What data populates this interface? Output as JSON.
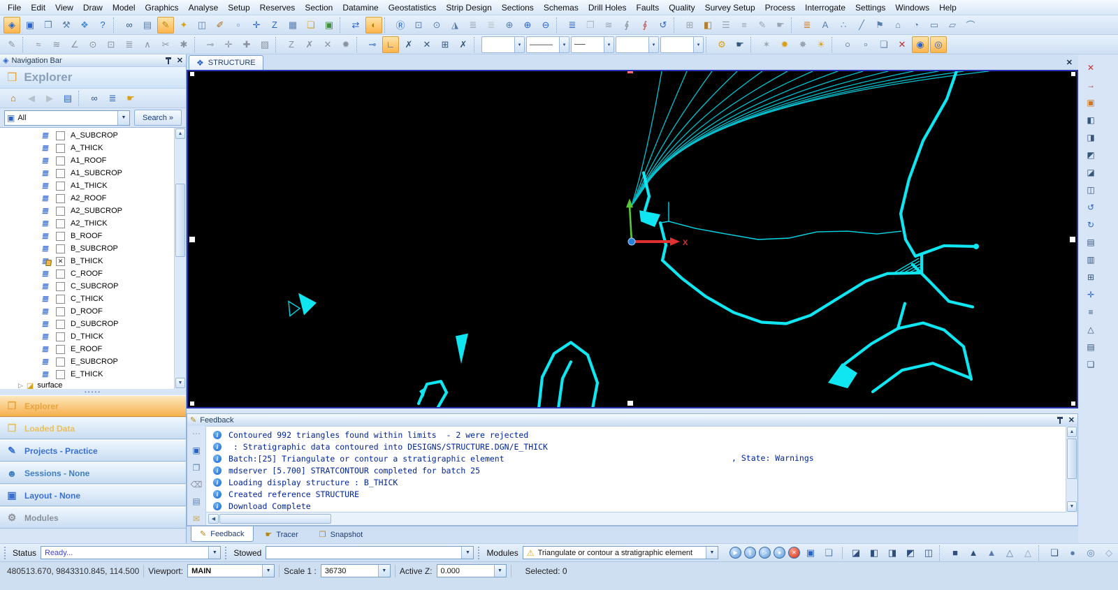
{
  "menu_items": [
    "File",
    "Edit",
    "View",
    "Draw",
    "Model",
    "Graphics",
    "Analyse",
    "Setup",
    "Reserves",
    "Section",
    "Datamine",
    "Geostatistics",
    "Strip Design",
    "Sections",
    "Schemas",
    "Drill Holes",
    "Faults",
    "Quality",
    "Survey Setup",
    "Process",
    "Interrogate",
    "Settings",
    "Windows",
    "Help"
  ],
  "toolbar1": [
    {
      "name": "rotate-view-icon",
      "glyph": "◈",
      "active": true,
      "color": "#2a64c8"
    },
    {
      "name": "plane-view-icon",
      "glyph": "▣",
      "color": "#2a64c8"
    },
    {
      "name": "cascade-windows-icon",
      "glyph": "❐",
      "color": "#5a7fae"
    },
    {
      "name": "customise-icon",
      "glyph": "⚒",
      "color": "#5a7fae"
    },
    {
      "name": "plugins-icon",
      "glyph": "❖",
      "color": "#4a8fd4"
    },
    {
      "name": "help-icon",
      "glyph": "?",
      "color": "#1a6fd4"
    },
    {
      "sep": true
    },
    {
      "name": "view-titles-icon",
      "glyph": "∞",
      "color": "#35567c"
    },
    {
      "name": "image-properties-icon",
      "glyph": "▤",
      "color": "#5a7fae"
    },
    {
      "name": "annotate-icon",
      "glyph": "✎",
      "active": true,
      "color": "#b8860b"
    },
    {
      "name": "highlight-icon",
      "glyph": "✦",
      "color": "#d8a018"
    },
    {
      "name": "split-display-icon",
      "glyph": "◫",
      "color": "#5a7fae"
    },
    {
      "name": "digitise-icon",
      "glyph": "✐",
      "color": "#b06a18"
    },
    {
      "name": "status-window-icon",
      "glyph": "▫",
      "color": "#5a7fae"
    },
    {
      "name": "move-view-icon",
      "glyph": "✛",
      "color": "#2a64c8"
    },
    {
      "name": "lock-z-icon",
      "glyph": "Z",
      "color": "#2a64c8"
    },
    {
      "name": "snapshot-image-icon",
      "glyph": "▦",
      "color": "#5a7fae"
    },
    {
      "name": "load-image-icon",
      "glyph": "❏",
      "color": "#d8a018"
    },
    {
      "name": "save-image-icon",
      "glyph": "▣",
      "color": "#3f8f3f"
    },
    {
      "sep": true
    },
    {
      "name": "refresh-icon",
      "glyph": "⇄",
      "color": "#2a64c8"
    },
    {
      "name": "design-data-icon",
      "glyph": "◐",
      "active": true,
      "color": "#b8860b"
    },
    {
      "sep": true
    },
    {
      "name": "redisplay-icon",
      "glyph": "Ⓡ",
      "color": "#1a5fd4"
    },
    {
      "name": "zoom-extents-icon",
      "glyph": "⊡",
      "color": "#5a7fae"
    },
    {
      "name": "zoom-select-icon",
      "glyph": "⊙",
      "color": "#5a7fae"
    },
    {
      "name": "select-surface-icon",
      "glyph": "◮",
      "color": "#5a7fae"
    },
    {
      "name": "hide-layers-icon",
      "glyph": "≣",
      "color": "#9aa4b0"
    },
    {
      "name": "show-layers-icon",
      "glyph": "≣",
      "color": "#b8c0c8"
    },
    {
      "name": "zoom-area-icon",
      "glyph": "⊕",
      "color": "#5a7fae"
    },
    {
      "name": "zoom-in-icon",
      "glyph": "⊕",
      "color": "#2a64c8"
    },
    {
      "name": "zoom-out-icon",
      "glyph": "⊖",
      "color": "#2a64c8"
    },
    {
      "sep": true
    },
    {
      "name": "loaded-layers-icon",
      "glyph": "≣",
      "color": "#2a64c8"
    },
    {
      "name": "open-data-icon",
      "glyph": "❒",
      "color": "#b0b6be"
    },
    {
      "name": "send-layers-icon",
      "glyph": "≋",
      "color": "#9aa4b0"
    },
    {
      "name": "attach-file-icon",
      "glyph": "∮",
      "color": "#7a828c"
    },
    {
      "name": "detach-file-icon",
      "glyph": "∮",
      "color": "#c04040"
    },
    {
      "name": "undo-icon",
      "glyph": "↺",
      "color": "#2a64c8"
    },
    {
      "sep": true
    },
    {
      "name": "grid-icon",
      "glyph": "⊞",
      "color": "#9aa4b0"
    },
    {
      "name": "fill-colour-icon",
      "glyph": "◧",
      "color": "#b08030"
    },
    {
      "name": "line-style-icon",
      "glyph": "☰",
      "color": "#9aa4b0"
    },
    {
      "name": "format-menu-icon",
      "glyph": "≡",
      "color": "#9aa4b0"
    },
    {
      "name": "paint-icon",
      "glyph": "✎",
      "color": "#9aa4b0"
    },
    {
      "name": "grab-icon",
      "glyph": "☛",
      "color": "#9aa4b0"
    },
    {
      "sep": true
    },
    {
      "name": "format-layers-icon",
      "glyph": "≣",
      "color": "#d07818"
    },
    {
      "name": "text-icon",
      "glyph": "A",
      "color": "#5a7fae"
    },
    {
      "name": "points-icon",
      "glyph": "∴",
      "color": "#5a7fae"
    },
    {
      "name": "line-icon",
      "glyph": "╱",
      "color": "#5a7fae"
    },
    {
      "name": "flag-icon",
      "glyph": "⚑",
      "color": "#5a7fae"
    },
    {
      "name": "polygon-icon",
      "glyph": "⌂",
      "color": "#5a7fae"
    },
    {
      "name": "circle-icon",
      "glyph": "◔",
      "color": "#5a7fae"
    },
    {
      "name": "rectangle-icon",
      "glyph": "▭",
      "color": "#5a7fae"
    },
    {
      "name": "parallelogram-icon",
      "glyph": "▱",
      "color": "#5a7fae"
    },
    {
      "name": "arc-icon",
      "glyph": "⌒",
      "color": "#5a7fae"
    }
  ],
  "toolbar2": [
    {
      "name": "edit-string-icon",
      "glyph": "✎",
      "color": "#8a92a0"
    },
    {
      "sep": true
    },
    {
      "name": "smooth-string-icon",
      "glyph": "≈",
      "color": "#8a92a0"
    },
    {
      "name": "filter-string-icon",
      "glyph": "≋",
      "color": "#8a92a0"
    },
    {
      "name": "measure-angle-icon",
      "glyph": "∠",
      "color": "#8a92a0"
    },
    {
      "name": "select-points-icon",
      "glyph": "⊙",
      "color": "#8a92a0"
    },
    {
      "name": "clip-strings-icon",
      "glyph": "⊡",
      "color": "#8a92a0"
    },
    {
      "name": "densify-string-icon",
      "glyph": "≣",
      "color": "#8a92a0"
    },
    {
      "name": "curve-fit-icon",
      "glyph": "∧",
      "color": "#8a92a0"
    },
    {
      "name": "break-string-icon",
      "glyph": "✂",
      "color": "#8a92a0"
    },
    {
      "name": "join-strings-icon",
      "glyph": "✱",
      "color": "#8a92a0"
    },
    {
      "sep": true
    },
    {
      "name": "extend-string-icon",
      "glyph": "⊸",
      "color": "#8a92a0"
    },
    {
      "name": "move-point-icon",
      "glyph": "✛",
      "color": "#8a92a0"
    },
    {
      "name": "insert-point-icon",
      "glyph": "✚",
      "color": "#8a92a0"
    },
    {
      "name": "delete-point-icon",
      "glyph": "▨",
      "color": "#8a92a0"
    },
    {
      "sep": true
    },
    {
      "name": "string-z-icon",
      "glyph": "Z",
      "color": "#8a92a0"
    },
    {
      "name": "point-edit-icon",
      "glyph": "✗",
      "color": "#8a92a0"
    },
    {
      "name": "segment-edit-icon",
      "glyph": "✕",
      "color": "#8a92a0"
    },
    {
      "name": "explode-string-icon",
      "glyph": "✹",
      "color": "#8a92a0"
    },
    {
      "sep": true
    },
    {
      "name": "snap-mode-icon",
      "glyph": "⊸",
      "color": "#2a64c8"
    },
    {
      "name": "snap-point-icon",
      "glyph": "∟",
      "active": true,
      "color": "#2a64c8"
    },
    {
      "name": "snap-line-icon",
      "glyph": "✗",
      "color": "#35567c"
    },
    {
      "name": "snap-intersection-icon",
      "glyph": "✕",
      "color": "#35567c"
    },
    {
      "name": "snap-grid-icon",
      "glyph": "⊞",
      "color": "#35567c"
    },
    {
      "name": "snap-clear-icon",
      "glyph": "✗",
      "color": "#35567c"
    },
    {
      "sep": true
    },
    {
      "combo": true,
      "name": "colour-picker",
      "glyph": " "
    },
    {
      "combo": true,
      "name": "line-style-picker",
      "glyph": "———"
    },
    {
      "combo": true,
      "name": "line-weight-picker",
      "glyph": "──"
    },
    {
      "combo": true,
      "name": "point-style-picker",
      "glyph": " "
    },
    {
      "combo": true,
      "name": "symbol-picker",
      "glyph": " "
    },
    {
      "sep": true
    },
    {
      "name": "lighting-icon",
      "glyph": "⚙",
      "color": "#d8a018"
    },
    {
      "name": "pan-hand-icon",
      "glyph": "☛",
      "color": "#35567c"
    },
    {
      "sep": true
    },
    {
      "name": "dim-lights-icon",
      "glyph": "✶",
      "color": "#9aa4b0"
    },
    {
      "name": "bright-lights-icon",
      "glyph": "✹",
      "color": "#d8a018"
    },
    {
      "name": "spotlight-icon",
      "glyph": "✸",
      "color": "#9aa4b0"
    },
    {
      "name": "sunlight-icon",
      "glyph": "☀",
      "color": "#d8a018"
    },
    {
      "sep": true
    },
    {
      "name": "lasso-select-icon",
      "glyph": "○",
      "color": "#35567c"
    },
    {
      "name": "box-select-icon",
      "glyph": "▫",
      "color": "#35567c"
    },
    {
      "name": "copy-selection-icon",
      "glyph": "❏",
      "color": "#5a7fae"
    },
    {
      "name": "clear-selection-icon",
      "glyph": "✕",
      "color": "#c03030"
    },
    {
      "name": "select-inside-icon",
      "glyph": "◉",
      "active": true,
      "color": "#2a64c8"
    },
    {
      "name": "select-outside-icon",
      "glyph": "◎",
      "active": true,
      "color": "#2a64c8"
    }
  ],
  "navbar": {
    "title": "Navigation Bar",
    "explorer_title": "Explorer",
    "search_value": "All",
    "search_button": "Search »",
    "tools": [
      {
        "name": "home-icon",
        "glyph": "⌂",
        "color": "#b06a18"
      },
      {
        "name": "back-icon",
        "glyph": "◀",
        "color": "#b8c2cc"
      },
      {
        "name": "forward-icon",
        "glyph": "▶",
        "color": "#b8c2cc"
      },
      {
        "name": "details-icon",
        "glyph": "▤",
        "color": "#2a64c8"
      },
      {
        "sep": true
      },
      {
        "name": "view-titles-icon",
        "glyph": "∞",
        "color": "#35567c"
      },
      {
        "name": "loaded-data-icon",
        "glyph": "≣",
        "color": "#2a64c8"
      },
      {
        "name": "drag-drop-icon",
        "glyph": "☛",
        "color": "#d8a018"
      }
    ]
  },
  "tree": {
    "items": [
      {
        "label": "A_SUBCROP"
      },
      {
        "label": "A_THICK"
      },
      {
        "label": "A1_ROOF"
      },
      {
        "label": "A1_SUBCROP"
      },
      {
        "label": "A1_THICK"
      },
      {
        "label": "A2_ROOF"
      },
      {
        "label": "A2_SUBCROP"
      },
      {
        "label": "A2_THICK"
      },
      {
        "label": "B_ROOF"
      },
      {
        "label": "B_SUBCROP"
      },
      {
        "label": "B_THICK",
        "checked": true,
        "locked": true
      },
      {
        "label": "C_ROOF"
      },
      {
        "label": "C_SUBCROP"
      },
      {
        "label": "C_THICK"
      },
      {
        "label": "D_ROOF"
      },
      {
        "label": "D_SUBCROP"
      },
      {
        "label": "D_THICK"
      },
      {
        "label": "E_ROOF"
      },
      {
        "label": "E_SUBCROP"
      },
      {
        "label": "E_THICK"
      }
    ],
    "surface_label": "surface"
  },
  "nav_buttons": [
    {
      "name": "navbtn-explorer",
      "label": "Explorer",
      "glyph": "❒",
      "color": "#e8a33c",
      "active": true
    },
    {
      "name": "navbtn-loaded-data",
      "label": "Loaded Data",
      "glyph": "❒",
      "color": "#e8c05a"
    },
    {
      "name": "navbtn-projects",
      "label": "Projects - Practice",
      "glyph": "✎",
      "color": "#3a6fd0"
    },
    {
      "name": "navbtn-sessions",
      "label": "Sessions - None",
      "glyph": "☻",
      "color": "#3f7fbf"
    },
    {
      "name": "navbtn-layout",
      "label": "Layout - None",
      "glyph": "▣",
      "color": "#3a6fd0"
    },
    {
      "name": "navbtn-modules",
      "label": "Modules",
      "glyph": "⚙",
      "color": "#8a8f98"
    }
  ],
  "view_window": {
    "tab_label": "STRUCTURE",
    "close_glyph": "✕",
    "axis_x_label": "X"
  },
  "feedback": {
    "title": "Feedback",
    "side_icons": [
      {
        "name": "grip-icon",
        "glyph": "⋯",
        "color": "#8aa0c0"
      },
      {
        "name": "save-log-icon",
        "glyph": "▣",
        "color": "#2a64c8"
      },
      {
        "name": "copy-log-icon",
        "glyph": "❐",
        "color": "#5a7fae"
      },
      {
        "name": "clear-log-icon",
        "glyph": "⌫",
        "color": "#8a92a0"
      },
      {
        "name": "print-log-icon",
        "glyph": "▤",
        "color": "#5a7fae"
      },
      {
        "name": "mail-log-icon",
        "glyph": "✉",
        "color": "#c8a850"
      }
    ],
    "messages": [
      {
        "text": "Contoured 992 triangles found within limits  - 2 were rejected"
      },
      {
        "text": " : Stratigraphic data contoured into DESIGNS/STRUCTURE.DGN/E_THICK"
      },
      {
        "text": "Batch:[25] Triangulate or contour a stratigraphic element",
        "tail": ", State: Warnings"
      },
      {
        "text": "mdserver [5.700] STRATCONTOUR completed for batch 25"
      },
      {
        "text": "Loading display structure : B_THICK"
      },
      {
        "text": "Created reference STRUCTURE"
      },
      {
        "text": "Download Complete"
      }
    ]
  },
  "bottom_tabs": [
    {
      "name": "tab-feedback",
      "label": "Feedback",
      "glyph": "✎",
      "active": true
    },
    {
      "name": "tab-tracer",
      "label": "Tracer",
      "glyph": "☛"
    },
    {
      "name": "tab-snapshot",
      "label": "Snapshot",
      "glyph": "❒"
    }
  ],
  "right_toolbar": [
    {
      "name": "close-views-icon",
      "glyph": "✕",
      "color": "#c03030"
    },
    {
      "name": "next-view-icon",
      "glyph": "→",
      "color": "#c03030"
    },
    {
      "name": "holes-display-icon",
      "glyph": "▣",
      "color": "#d07818"
    },
    {
      "name": "section-view-icon",
      "glyph": "◧",
      "color": "#35567c"
    },
    {
      "name": "plan-view-icon",
      "glyph": "◨",
      "color": "#35567c"
    },
    {
      "name": "front-view-icon",
      "glyph": "◩",
      "color": "#35567c"
    },
    {
      "name": "back-view-icon",
      "glyph": "◪",
      "color": "#35567c"
    },
    {
      "name": "iso-view-icon",
      "glyph": "◫",
      "color": "#35567c"
    },
    {
      "name": "rotate-left-icon",
      "glyph": "↺",
      "color": "#2a64c8"
    },
    {
      "name": "rotate-right-icon",
      "glyph": "↻",
      "color": "#2a64c8"
    },
    {
      "name": "walls-icon",
      "glyph": "▤",
      "color": "#35567c"
    },
    {
      "name": "floor-icon",
      "glyph": "▥",
      "color": "#35567c"
    },
    {
      "name": "grid-3d-icon",
      "glyph": "⊞",
      "color": "#35567c"
    },
    {
      "name": "axes-icon",
      "glyph": "✛",
      "color": "#2a64c8"
    },
    {
      "name": "scale-bar-icon",
      "glyph": "≡",
      "color": "#35567c"
    },
    {
      "name": "north-arrow-icon",
      "glyph": "△",
      "color": "#35567c"
    },
    {
      "name": "legend-icon",
      "glyph": "▤",
      "color": "#35567c"
    },
    {
      "name": "overlay-icon",
      "glyph": "❏",
      "color": "#35567c"
    }
  ],
  "status1": {
    "status_label": "Status",
    "status_value": "Ready...",
    "stowed_label": "Stowed",
    "stowed_value": "",
    "modules_label": "Modules",
    "modules_value": "Triangulate or contour a stratigraphic element",
    "warning_glyph": "⚠",
    "media_icons": [
      {
        "name": "run-process-icon",
        "glyph": "▶",
        "bg": "round"
      },
      {
        "name": "pause-process-icon",
        "glyph": "∥",
        "bg": "round"
      },
      {
        "name": "step-process-icon",
        "glyph": "▷",
        "bg": "round"
      },
      {
        "name": "queue-process-icon",
        "glyph": "●",
        "bg": "round"
      },
      {
        "name": "stop-process-icon",
        "glyph": "✕",
        "bg": "round-red2"
      },
      {
        "name": "save-session-icon",
        "glyph": "▣",
        "color": "#2a64c8"
      },
      {
        "name": "processes-window-icon",
        "glyph": "❏",
        "color": "#5a7fae"
      }
    ],
    "view_icons": [
      {
        "name": "view-plane-1-icon",
        "glyph": "◪",
        "color": "#2f4f7f"
      },
      {
        "name": "view-plane-2-icon",
        "glyph": "◧",
        "color": "#2f4f7f"
      },
      {
        "name": "view-plane-3-icon",
        "glyph": "◨",
        "color": "#2f4f7f"
      },
      {
        "name": "view-plane-4-icon",
        "glyph": "◩",
        "color": "#2f4f7f"
      },
      {
        "name": "view-plane-5-icon",
        "glyph": "◫",
        "color": "#2f4f7f"
      },
      {
        "sep": true
      },
      {
        "name": "solid-cube-icon",
        "glyph": "■",
        "color": "#2f4f7f"
      },
      {
        "name": "solid-pyramid-icon",
        "glyph": "▲",
        "color": "#2f4f7f"
      },
      {
        "name": "solid-pyramid-2-icon",
        "glyph": "▲",
        "color": "#5a7fae"
      },
      {
        "name": "wire-pyramid-icon",
        "glyph": "△",
        "color": "#5a7fae"
      },
      {
        "name": "wire-pyramid-2-icon",
        "glyph": "△",
        "color": "#8aa4c0"
      },
      {
        "sep": true
      },
      {
        "name": "block-model-icon",
        "glyph": "❏",
        "color": "#2f4f7f"
      },
      {
        "name": "sphere-icon",
        "glyph": "●",
        "color": "#5a7fae"
      },
      {
        "name": "ring-icon",
        "glyph": "◎",
        "color": "#5a7fae"
      },
      {
        "name": "wedge-icon",
        "glyph": "◇",
        "color": "#8aa4c0"
      }
    ]
  },
  "status2": {
    "coords": "480513.670, 9843310.845, 114.500",
    "viewport_label": "Viewport:",
    "viewport_value": "MAIN",
    "scale_label": "Scale 1 :",
    "scale_value": "36730",
    "activez_label": "Active Z:",
    "activez_value": "0.000",
    "selected": "Selected: 0"
  }
}
